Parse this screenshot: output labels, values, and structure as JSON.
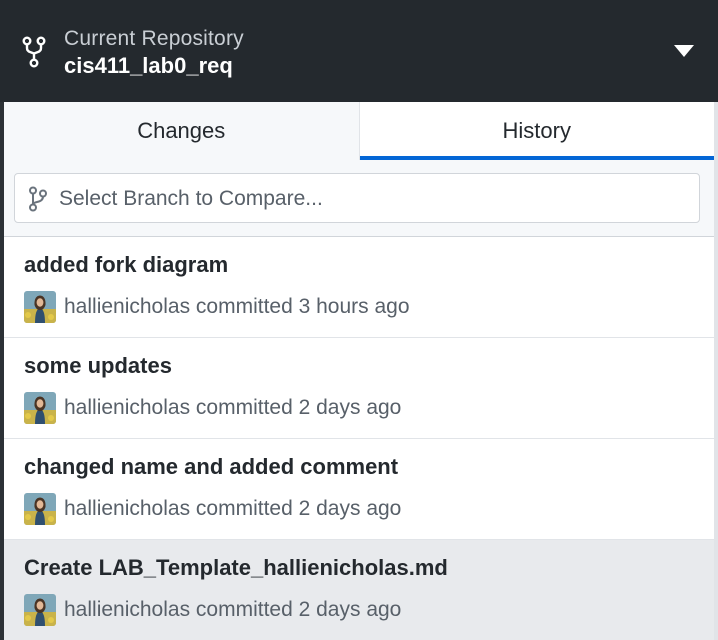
{
  "header": {
    "caption": "Current Repository",
    "repository_name": "cis411_lab0_req",
    "repo_icon": "repo-forked-icon",
    "dropdown_icon": "triangle-down-icon"
  },
  "tabs": [
    {
      "label": "Changes",
      "selected": false
    },
    {
      "label": "History",
      "selected": true
    }
  ],
  "compare": {
    "placeholder": "Select Branch to Compare...",
    "icon": "git-branch-icon"
  },
  "commits": [
    {
      "summary": "added fork diagram",
      "byline": "hallienicholas committed 3 hours ago",
      "selected": false
    },
    {
      "summary": "some updates",
      "byline": "hallienicholas committed 2 days ago",
      "selected": false
    },
    {
      "summary": "changed name and added comment",
      "byline": "hallienicholas committed 2 days ago",
      "selected": false
    },
    {
      "summary": "Create LAB_Template_hallienicholas.md",
      "byline": "hallienicholas committed 2 days ago",
      "selected": true
    }
  ],
  "colors": {
    "header_bg": "#24292e",
    "accent": "#0366d6",
    "selected_row": "#e8eaed"
  }
}
